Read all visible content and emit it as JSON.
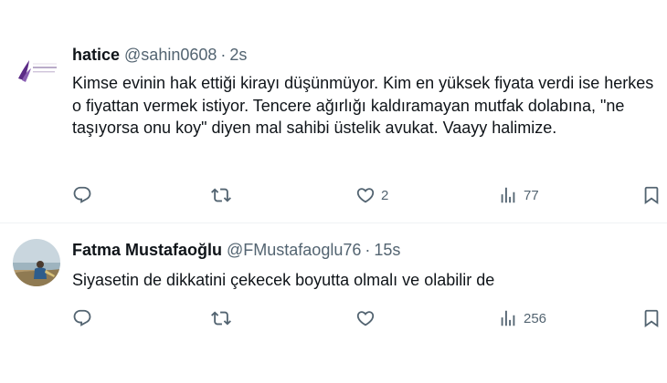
{
  "tweets": [
    {
      "author_name": "hatice",
      "handle": "@sahin0608",
      "separator": "·",
      "time": "2s",
      "avatar_logo_text": "M.C.D. DANIŞMANLIK",
      "text": "Kimse evinin hak ettiği kirayı düşünmüyor. Kim en yüksek fiyata verdi ise herkes o fiyattan vermek istiyor. Tencere ağırlığı kaldıramayan mutfak dolabına, \"ne taşıyorsa onu koy\" diyen mal sahibi üstelik avukat. Vaayy halimize.",
      "actions": {
        "reply_icon": "reply-icon",
        "retweet_icon": "retweet-icon",
        "like_icon": "heart-icon",
        "like_count": "2",
        "views_icon": "views-icon",
        "views_count": "77",
        "bookmark_icon": "bookmark-icon"
      }
    },
    {
      "author_name": "Fatma Mustafaoğlu",
      "handle": "@FMustafaoglu76",
      "separator": "·",
      "time": "15s",
      "text": "Siyasetin de dikkatini çekecek boyutta olmalı ve olabilir de",
      "actions": {
        "reply_icon": "reply-icon",
        "retweet_icon": "retweet-icon",
        "like_icon": "heart-icon",
        "like_count": "",
        "views_icon": "views-icon",
        "views_count": "256",
        "bookmark_icon": "bookmark-icon"
      }
    }
  ],
  "colors": {
    "text_primary": "#0f1419",
    "text_secondary": "#536471",
    "divider": "#eff3f4",
    "avatar_logo_purple": "#5b2a86"
  }
}
